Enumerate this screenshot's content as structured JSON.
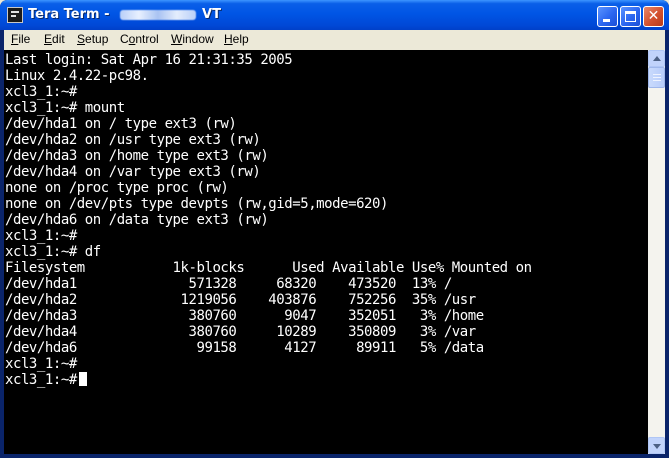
{
  "window": {
    "title_prefix": "Tera Term - ",
    "title_suffix": "VT"
  },
  "titlebar_buttons": {
    "close_glyph": "✕"
  },
  "menu": [
    {
      "accel": "F",
      "rest": "ile"
    },
    {
      "accel": "E",
      "rest": "dit"
    },
    {
      "accel": "S",
      "rest": "etup"
    },
    {
      "accel": "",
      "pre": "C",
      "accel2": "o",
      "rest": "ntrol"
    },
    {
      "accel": "W",
      "rest": "indow"
    },
    {
      "accel": "H",
      "rest": "elp"
    }
  ],
  "terminal": {
    "lines": [
      "Last login: Sat Apr 16 21:31:35 2005",
      "Linux 2.4.22-pc98.",
      "xcl3_1:~#",
      "xcl3_1:~# mount",
      "/dev/hda1 on / type ext3 (rw)",
      "/dev/hda2 on /usr type ext3 (rw)",
      "/dev/hda3 on /home type ext3 (rw)",
      "/dev/hda4 on /var type ext3 (rw)",
      "none on /proc type proc (rw)",
      "none on /dev/pts type devpts (rw,gid=5,mode=620)",
      "/dev/hda6 on /data type ext3 (rw)",
      "xcl3_1:~#",
      "xcl3_1:~# df",
      "Filesystem           1k-blocks      Used Available Use% Mounted on",
      "/dev/hda1              571328     68320    473520  13% /",
      "/dev/hda2             1219056    403876    752256  35% /usr",
      "/dev/hda3              380760      9047    352051   3% /home",
      "/dev/hda4              380760     10289    350809   3% /var",
      "/dev/hda6               99158      4127     89911   5% /data",
      "xcl3_1:~#"
    ],
    "prompt": "xcl3_1:~#"
  }
}
